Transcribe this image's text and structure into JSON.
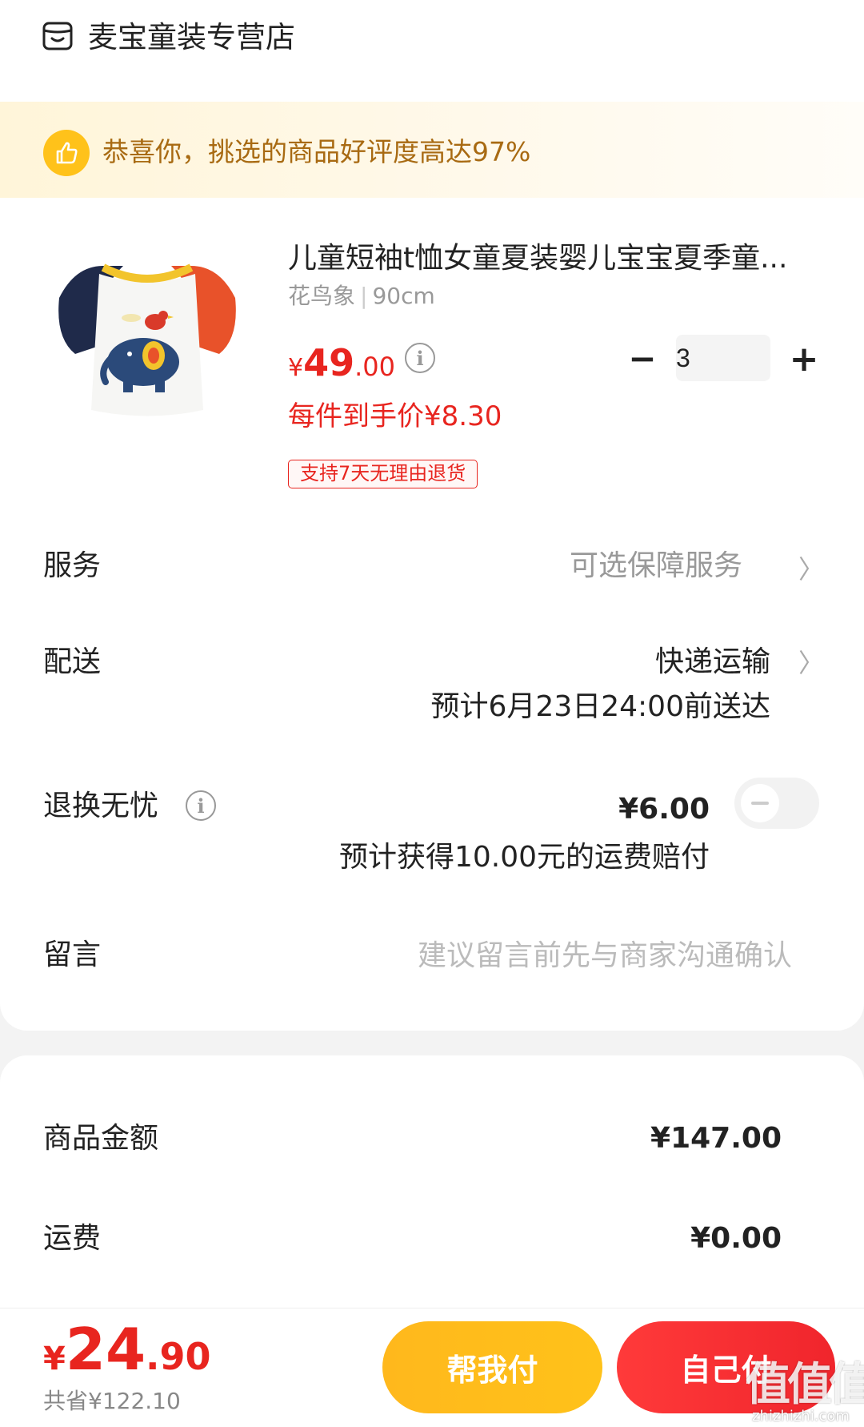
{
  "shop": {
    "name": "麦宝童装专营店",
    "icon": "store-icon"
  },
  "banner": {
    "text": "恭喜你，挑选的商品好评度高达97%",
    "icon": "thumbs-up-icon"
  },
  "product": {
    "title": "儿童短袖t恤女童夏装婴儿宝宝夏季童...",
    "spec_name": "花鸟象",
    "spec_separator": "|",
    "spec_size": "90cm",
    "price_currency": "¥",
    "price_integer": "49",
    "price_decimal": ".00",
    "unit_price_label": "每件到手价¥8.30",
    "return_tag": "支持7天无理由退货",
    "quantity": "3",
    "minus_label": "−",
    "plus_label": "+"
  },
  "service": {
    "label": "服务",
    "value": "可选保障服务",
    "chevron": "〉"
  },
  "shipping": {
    "label": "配送",
    "value": "快递运输",
    "eta": "预计6月23日24:00前送达",
    "chevron": "〉"
  },
  "return_worry_free": {
    "label": "退换无忧",
    "price": "¥6.00",
    "note": "预计获得10.00元的运费赔付",
    "enabled": false
  },
  "message": {
    "label": "留言",
    "placeholder": "建议留言前先与商家沟通确认"
  },
  "summary": {
    "goods_label": "商品金额",
    "goods_value": "¥147.00",
    "freight_label": "运费",
    "freight_value": "¥0.00"
  },
  "footer": {
    "total_currency": "¥",
    "total_integer": "24",
    "total_decimal": ".90",
    "saved": "共省¥122.10",
    "help_pay_label": "帮我付",
    "self_pay_label": "自己付"
  },
  "watermark": {
    "glyphs": "值值值",
    "text": "zhizhizhi.com"
  },
  "colors": {
    "price_red": "#e8251f",
    "help_yellow": "#ffc21a",
    "pay_red": "#f0252c",
    "banner_text": "#a86a12"
  }
}
